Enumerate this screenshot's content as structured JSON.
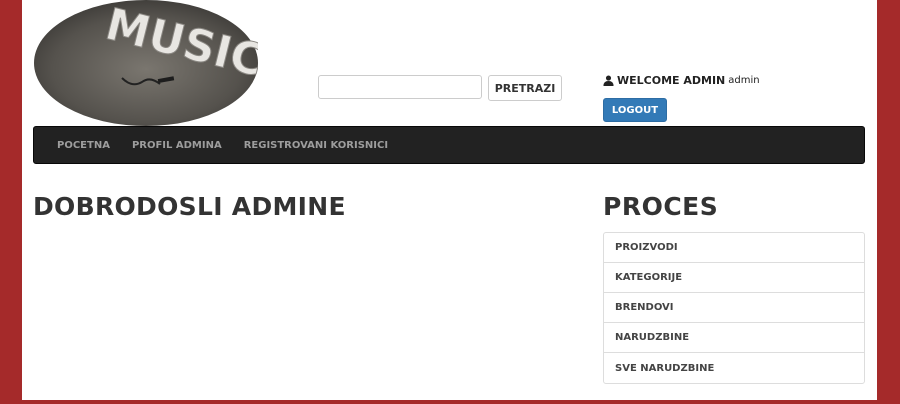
{
  "header": {
    "logo_text": "MUSIC",
    "search": {
      "placeholder": "",
      "value": "",
      "button_label": "PRETRAZI"
    },
    "welcome_label": "WELCOME ADMIN",
    "user_name": "admin",
    "logout_label": "LOGOUT"
  },
  "nav": {
    "items": [
      {
        "label": "POCETNA"
      },
      {
        "label": "PROFIL ADMINA"
      },
      {
        "label": "REGISTROVANI KORISNICI"
      }
    ]
  },
  "main": {
    "title": "DOBRODOSLI ADMINE"
  },
  "sidebar": {
    "title": "PROCES",
    "items": [
      {
        "label": "PROIZVODI"
      },
      {
        "label": "KATEGORIJE"
      },
      {
        "label": "BRENDOVI"
      },
      {
        "label": "NARUDZBINE"
      },
      {
        "label": "SVE NARUDZBINE"
      }
    ]
  },
  "colors": {
    "background": "#a52a2a",
    "navbar": "#222222",
    "logout_button": "#337ab7"
  },
  "icons": {
    "user": "user-icon"
  }
}
